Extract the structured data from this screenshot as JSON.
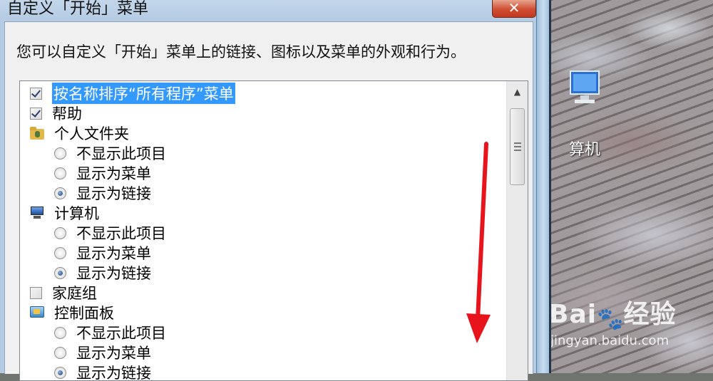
{
  "dialog": {
    "title": "自定义「开始」菜单",
    "close_glyph": "✕",
    "description": "您可以自定义「开始」菜单上的链接、图标以及菜单的外观和行为。"
  },
  "list": {
    "items": [
      {
        "kind": "checkbox",
        "checked": true,
        "label": "按名称排序“所有程序”菜单",
        "selected": true
      },
      {
        "kind": "checkbox",
        "checked": true,
        "label": "帮助"
      },
      {
        "kind": "folder-icon",
        "label": "个人文件夹"
      },
      {
        "kind": "radio",
        "checked": false,
        "label": "不显示此项目"
      },
      {
        "kind": "radio",
        "checked": false,
        "label": "显示为菜单"
      },
      {
        "kind": "radio",
        "checked": true,
        "label": "显示为链接"
      },
      {
        "kind": "computer-icon",
        "label": "计算机"
      },
      {
        "kind": "radio",
        "checked": false,
        "label": "不显示此项目"
      },
      {
        "kind": "radio",
        "checked": false,
        "label": "显示为菜单"
      },
      {
        "kind": "radio",
        "checked": true,
        "label": "显示为链接"
      },
      {
        "kind": "checkbox",
        "checked": false,
        "label": "家庭组"
      },
      {
        "kind": "control-panel-icon",
        "label": "控制面板"
      },
      {
        "kind": "radio",
        "checked": false,
        "label": "不显示此项目"
      },
      {
        "kind": "radio",
        "checked": false,
        "label": "显示为菜单"
      },
      {
        "kind": "radio",
        "checked": true,
        "label": "显示为链接"
      }
    ]
  },
  "desktop": {
    "icon_label": "算机",
    "watermark_logo": "Bai",
    "watermark_paw": "🐾",
    "watermark_tail": "经验",
    "watermark_url": "jingyan.baidu.com"
  },
  "colors": {
    "selection": "#3399ff",
    "arrow": "#e8141b",
    "close_button": "#cf4d32"
  }
}
